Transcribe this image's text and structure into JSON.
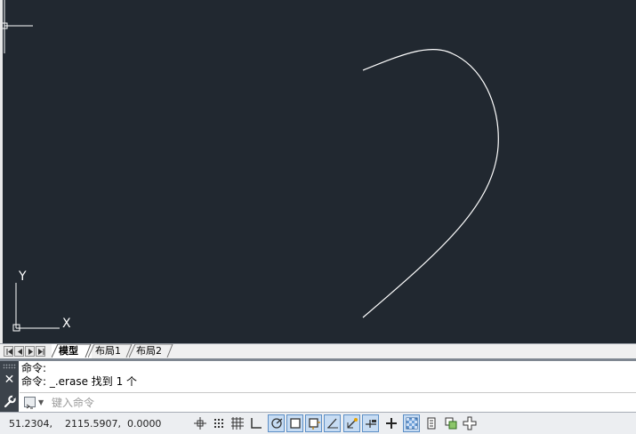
{
  "layout_tabs": [
    {
      "label": "模型",
      "active": true
    },
    {
      "label": "布局1",
      "active": false
    },
    {
      "label": "布局2",
      "active": false
    }
  ],
  "ucs": {
    "y_label": "Y",
    "x_label": "X"
  },
  "command": {
    "history": [
      "命令:",
      "命令: _.erase 找到 1 个"
    ],
    "input_placeholder": "键入命令"
  },
  "status": {
    "coordinates": "51.2304,    2115.5907,  0.0000"
  },
  "status_tools": [
    "infer-constraints-icon",
    "snap-mode-icon",
    "grid-display-icon",
    "ortho-mode-icon",
    "polar-tracking-icon",
    "object-snap-icon",
    "3d-object-snap-icon",
    "object-snap-tracking-icon",
    "dynamic-ucs-icon",
    "dynamic-input-icon",
    "lineweight-icon",
    "transparency-icon",
    "quick-properties-icon",
    "selection-cycling-icon",
    "annotation-monitor-icon"
  ],
  "colors": {
    "canvas_bg": "#212830",
    "drawing_stroke": "#ffffff",
    "command_bar": "#3c434b"
  }
}
